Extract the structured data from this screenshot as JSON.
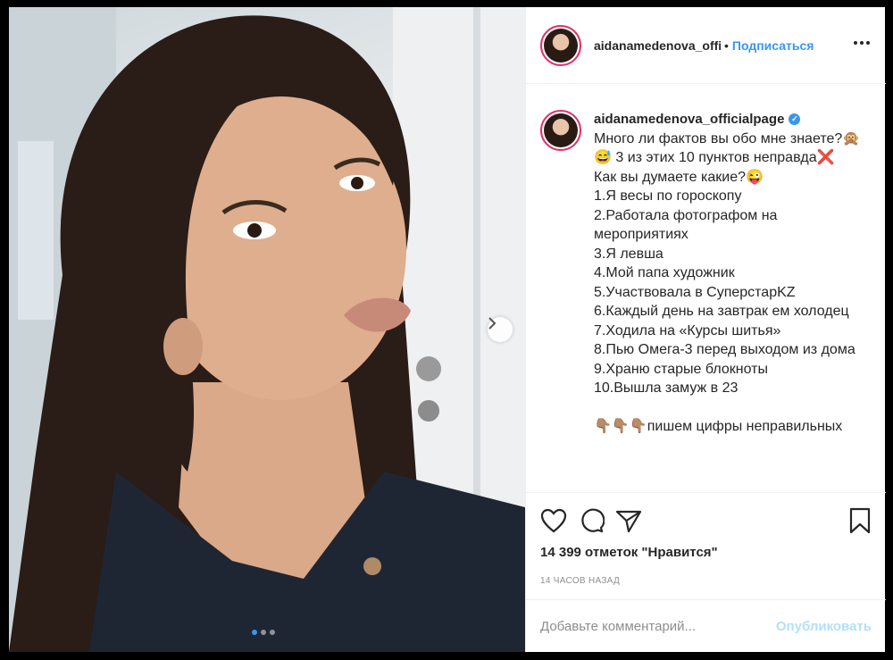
{
  "header": {
    "username": "aidanamedenova_officialpage",
    "separator": "•",
    "follow_label": "Подписаться",
    "more_icon": "more-icon"
  },
  "caption": {
    "owner": "aidanamedenova_officialpage",
    "verified_icon": "verified-icon",
    "intro_line": "Много ли фактов вы обо мне знаете?🙊😅 3 из этих 10 пунктов неправда❌",
    "question": "Как вы думаете какие?😜",
    "items": [
      "1.Я весы по гороскопу",
      "2.Работала фотографом на мероприятиях",
      "3.Я левша",
      "4.Мой папа художник",
      "5.Участвовала в СуперстарKZ",
      "6.Каждый день на завтрак ем холодец",
      "7.Ходила на «Курсы шитья»",
      "8.Пью Омега-3 перед выходом из дома",
      "9.Храню старые блокноты",
      "10.Вышла замуж в 23"
    ],
    "trailing": "👇🏽👇🏽👇🏽пишем цифры неправильных"
  },
  "actions": {
    "like_icon": "heart-icon",
    "comment_icon": "comment-icon",
    "share_icon": "share-icon",
    "save_icon": "bookmark-icon"
  },
  "likes_text": "14 399 отметок \"Нравится\"",
  "time_text": "14 ЧАСОВ НАЗАД",
  "comment": {
    "placeholder": "Добавьте комментарий...",
    "publish_label": "Опубликовать"
  },
  "carousel": {
    "total": 3,
    "active_index": 0,
    "next_icon": "chevron-right-icon"
  },
  "colors": {
    "accent": "#3897f0",
    "publish_disabled": "#b2dffc",
    "muted": "#8e8e8e"
  }
}
